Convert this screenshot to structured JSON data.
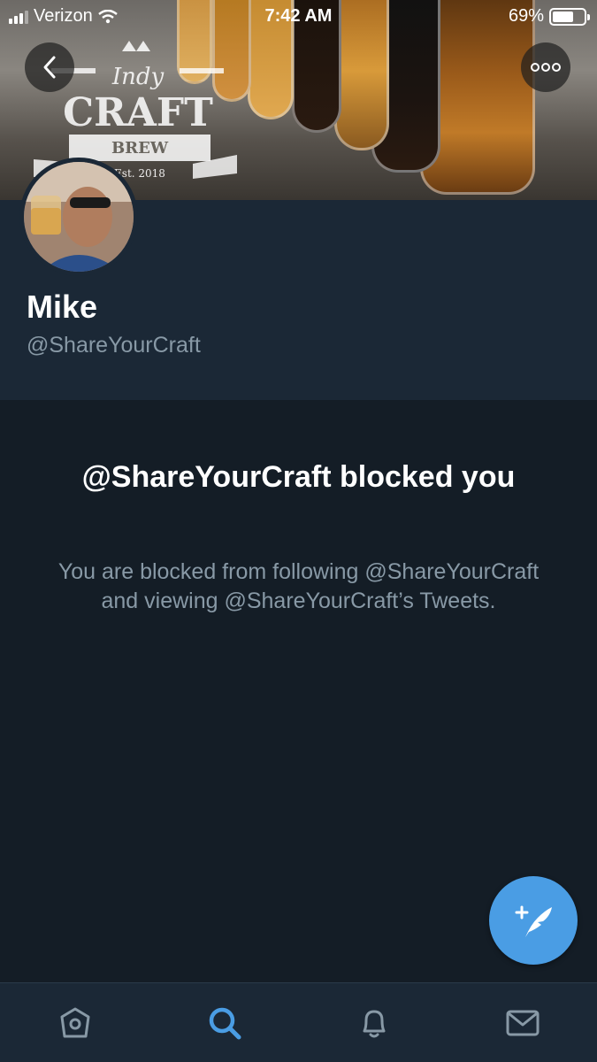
{
  "status_bar": {
    "carrier": "Verizon",
    "time": "7:42 AM",
    "battery_percent": "69%",
    "battery_level": 0.69
  },
  "banner": {
    "logo_top": "Indy",
    "logo_main": "CRAFT",
    "logo_sub": "BREW",
    "logo_est": "Est. 2018"
  },
  "header_actions": {
    "back_icon": "chevron-left-icon",
    "more_icon": "more-dots-icon"
  },
  "profile": {
    "name": "Mike",
    "handle": "@ShareYourCraft"
  },
  "blocked": {
    "title": "@ShareYourCraft blocked you",
    "message": "You are blocked from following @ShareYourCraft and viewing @ShareYourCraft’s Tweets."
  },
  "compose": {
    "icon": "compose-tweet-icon"
  },
  "tab_bar": {
    "tabs": [
      {
        "icon": "home-icon",
        "active": false
      },
      {
        "icon": "search-icon",
        "active": true
      },
      {
        "icon": "bell-icon",
        "active": false
      },
      {
        "icon": "mail-icon",
        "active": false
      }
    ]
  },
  "colors": {
    "background": "#141d26",
    "profile_bg": "#1b2836",
    "accent": "#4a9de4",
    "secondary_text": "#8899a6"
  }
}
